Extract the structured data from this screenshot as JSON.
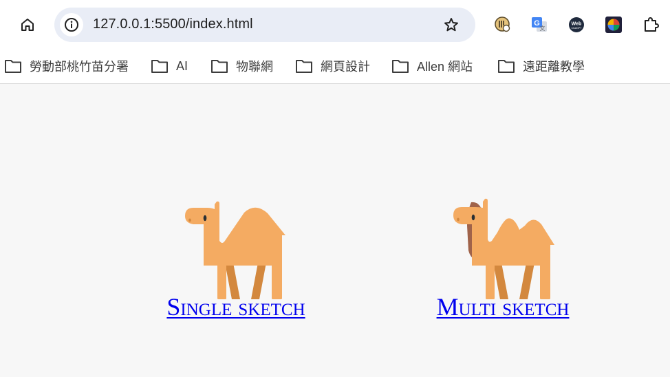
{
  "browser": {
    "url": "127.0.0.1:5500/index.html",
    "icons": {
      "home": "home-icon",
      "site_info": "info-icon",
      "bookmark_star": "star-icon",
      "extensions": [
        "wallet-extension-icon",
        "google-translate-extension-icon",
        "webchatgpt-extension-icon",
        "colorful-extension-icon",
        "extensions-puzzle-icon"
      ]
    }
  },
  "bookmarks": [
    {
      "label": "勞動部桃竹苗分署"
    },
    {
      "label": "AI"
    },
    {
      "label": "物聯網"
    },
    {
      "label": "網頁設計"
    },
    {
      "label": "Allen 網站"
    },
    {
      "label": "遠距離教學"
    }
  ],
  "page": {
    "links": [
      {
        "label": "Single sketch",
        "icon": "one-hump-camel-icon"
      },
      {
        "label": "Multi sketch",
        "icon": "two-hump-camel-icon"
      }
    ]
  },
  "colors": {
    "camel_body": "#f4ab62",
    "camel_back_legs": "#d3883e",
    "camel_saddle": "#a0634a",
    "link": "#0000ee",
    "page_background": "#f7f7f7",
    "omnibox": "#e9edf6"
  }
}
